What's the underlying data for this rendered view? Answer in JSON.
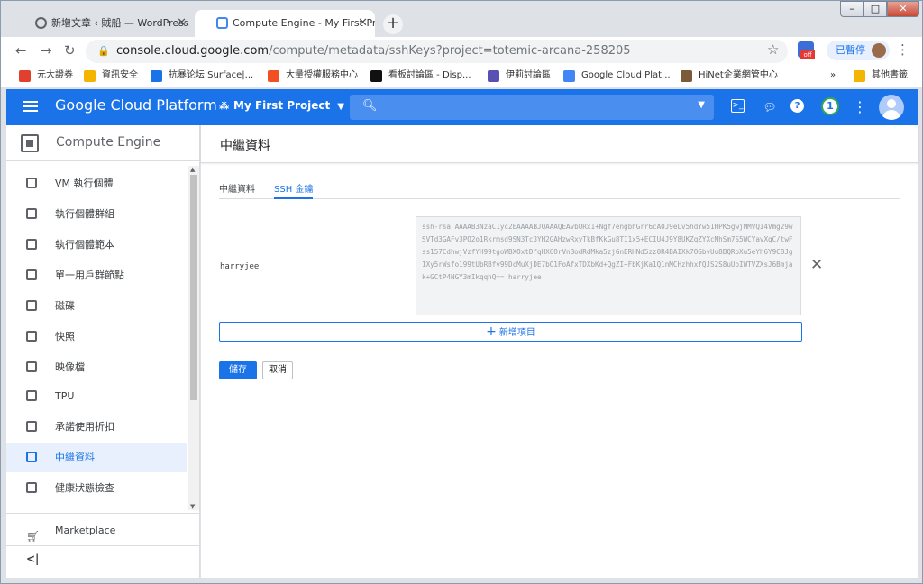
{
  "browser": {
    "tabs": [
      {
        "title": "新增文章 ‹ 賊船 — WordPress",
        "active": false
      },
      {
        "title": "Compute Engine - My First Proj",
        "active": true
      }
    ],
    "url_host": "console.cloud.google.com",
    "url_path": "/compute/metadata/sshKeys?project=totemic-arcana-258205",
    "paused_label": "已暫停",
    "ext_badge": "off",
    "bookmarks": [
      {
        "label": "元大證券",
        "color": "#e0402d"
      },
      {
        "label": "資訊安全",
        "color": "#f4b400"
      },
      {
        "label": "抗暴论坛 Surface|...",
        "color": "#1a73e8"
      },
      {
        "label": "大量授權服務中心",
        "color": "#f25022"
      },
      {
        "label": "看板討論區 - Disp...",
        "color": "#111111"
      },
      {
        "label": "伊莉討論區",
        "color": "#5a4fb3"
      },
      {
        "label": "Google Cloud Plat...",
        "color": "#4285f4"
      },
      {
        "label": "HiNet企業網管中心",
        "color": "#7b5a3a"
      }
    ],
    "bookmarks_more": "»",
    "other_bookmarks": "其他書籤"
  },
  "gcp": {
    "brand": "Google Cloud Platform",
    "project": "My First Project",
    "notifications": "1"
  },
  "sidebar": {
    "title": "Compute Engine",
    "items": [
      {
        "label": "VM 執行個體",
        "active": false
      },
      {
        "label": "執行個體群組",
        "active": false
      },
      {
        "label": "執行個體範本",
        "active": false
      },
      {
        "label": "單一用戶群節點",
        "active": false
      },
      {
        "label": "磁碟",
        "active": false
      },
      {
        "label": "快照",
        "active": false
      },
      {
        "label": "映像檔",
        "active": false
      },
      {
        "label": "TPU",
        "active": false
      },
      {
        "label": "承諾使用折扣",
        "active": false
      },
      {
        "label": "中繼資料",
        "active": true
      },
      {
        "label": "健康狀態檢查",
        "active": false
      }
    ],
    "marketplace": "Marketplace",
    "collapse": "<|"
  },
  "main": {
    "title": "中繼資料",
    "tabs": [
      {
        "label": "中繼資料",
        "active": false
      },
      {
        "label": "SSH 金鑰",
        "active": true
      }
    ],
    "ssh_user": "harryjee",
    "ssh_key": "ssh-rsa AAAAB3NzaC1yc2EAAAABJQAAAQEAvbURx1+Ngf7engbhGrr6cA0J9eLv5hdYw51HPK5gwjMMVQI4Vmg29wSVTd3GAFv3PO2o1Rkrmsd9SN3Tc3YH2GAHzwRxyTkBfKkGu8TI1x5+ECIU4J9Y8UKZqZYXcMhSm7S5WCYavXqC/twFss157CdhwjVzfYH99tgoWBXOxtDfqHX6OrVnBodRdMka5zjGnERHNd5zz0R4BAIXk7OGbvUu8BQRoXu5eYh6Y9C8Jg1Xy5rWsfo199tUbRBfv99DcMuXjDE7bO1FoAfxTDXbKd+QgZI+FbKjKa1Q1nMCHzhhxfQJS2S8uUoIWTVZXsJ6Bmjak+GCtP4NGY3mIkqqhQ== harryjee",
    "add_item": "新增項目",
    "save": "儲存",
    "cancel": "取消"
  }
}
